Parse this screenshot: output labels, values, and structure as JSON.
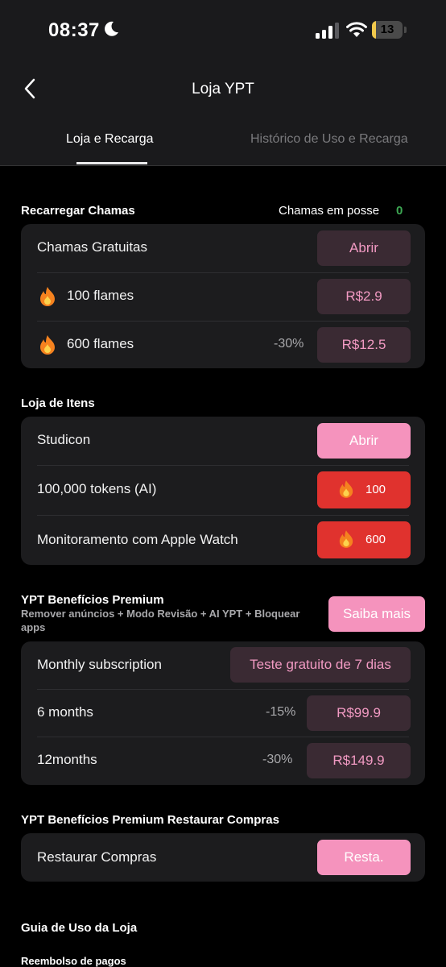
{
  "status_bar": {
    "time": "08:37",
    "battery": "13",
    "battery_level": 0.13
  },
  "header": {
    "title": "Loja YPT",
    "tabs": [
      {
        "label": "Loja e Recarga",
        "active": true
      },
      {
        "label": "Histórico de Uso e Recarga",
        "active": false
      }
    ]
  },
  "recharge": {
    "title": "Recarregar Chamas",
    "owned_label": "Chamas em posse",
    "owned_count": "0",
    "rows": [
      {
        "label": "Chamas Gratuitas",
        "button": "Abrir"
      },
      {
        "label": "100 flames",
        "button": "R$2.9"
      },
      {
        "label": "600 flames",
        "discount": "-30%",
        "button": "R$12.5"
      }
    ]
  },
  "items": {
    "title": "Loja de Itens",
    "rows": [
      {
        "label": "Studicon",
        "button": "Abrir"
      },
      {
        "label": "100,000 tokens (AI)",
        "price": "100"
      },
      {
        "label": "Monitoramento com Apple Watch",
        "price": "600"
      }
    ]
  },
  "premium": {
    "title": "YPT Benefícios Premium",
    "subtitle": "Remover anúncios + Modo Revisão + AI YPT + Bloquear apps",
    "more_button": "Saiba mais",
    "rows": [
      {
        "label": "Monthly subscription",
        "button": "Teste gratuito de 7 dias"
      },
      {
        "label": "6 months",
        "discount": "-15%",
        "button": "R$99.9"
      },
      {
        "label": "12months",
        "discount": "-30%",
        "button": "R$149.9"
      }
    ]
  },
  "restore": {
    "title": "YPT Benefícios Premium Restaurar Compras",
    "rows": [
      {
        "label": "Restaurar Compras",
        "button": "Resta."
      }
    ]
  },
  "guide": {
    "title": "Guia de Uso da Loja",
    "subtitle": "Reembolso de pagos"
  },
  "colors": {
    "accent_pink": "#f593bd",
    "dark_button": "#3a2a33",
    "flame_red": "#e0322e",
    "owned_green": "#3da853"
  }
}
